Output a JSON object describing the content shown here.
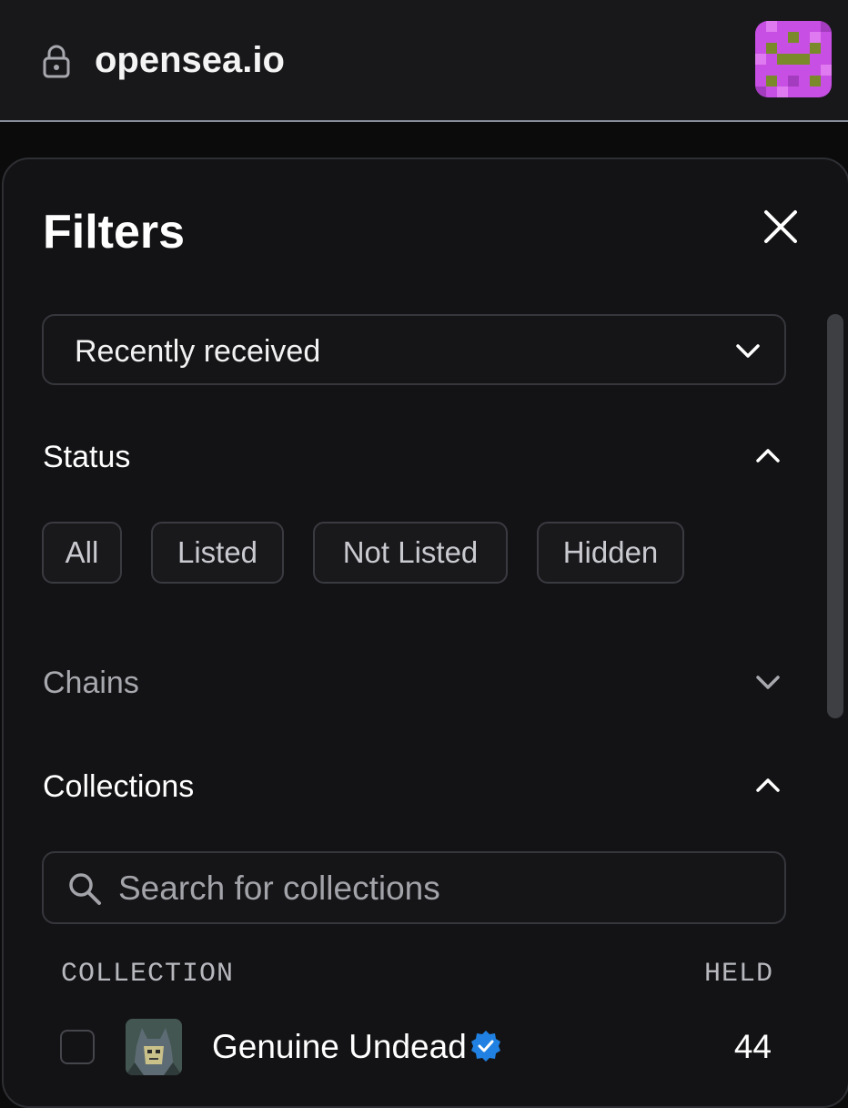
{
  "browser": {
    "url": "opensea.io",
    "lock_icon": "lock-icon",
    "avatar_icon": "pixel-avatar"
  },
  "filters": {
    "title": "Filters",
    "close_icon": "close-icon",
    "sort": {
      "selected": "Recently received",
      "icon": "chevron-down-icon"
    },
    "status": {
      "title": "Status",
      "expanded": true,
      "options": [
        "All",
        "Listed",
        "Not Listed",
        "Hidden"
      ]
    },
    "chains": {
      "title": "Chains",
      "expanded": false
    },
    "collections": {
      "title": "Collections",
      "expanded": true,
      "search_placeholder": "Search for collections",
      "header_collection": "COLLECTION",
      "header_held": "HELD",
      "rows": [
        {
          "name": "Genuine Undead",
          "verified": true,
          "held": "44"
        }
      ]
    }
  },
  "colors": {
    "background": "#0b0b0c",
    "panel": "#131315",
    "verified": "#2081e2",
    "avatar_pink": "#c84fe3",
    "avatar_olive": "#7a8a2a"
  }
}
